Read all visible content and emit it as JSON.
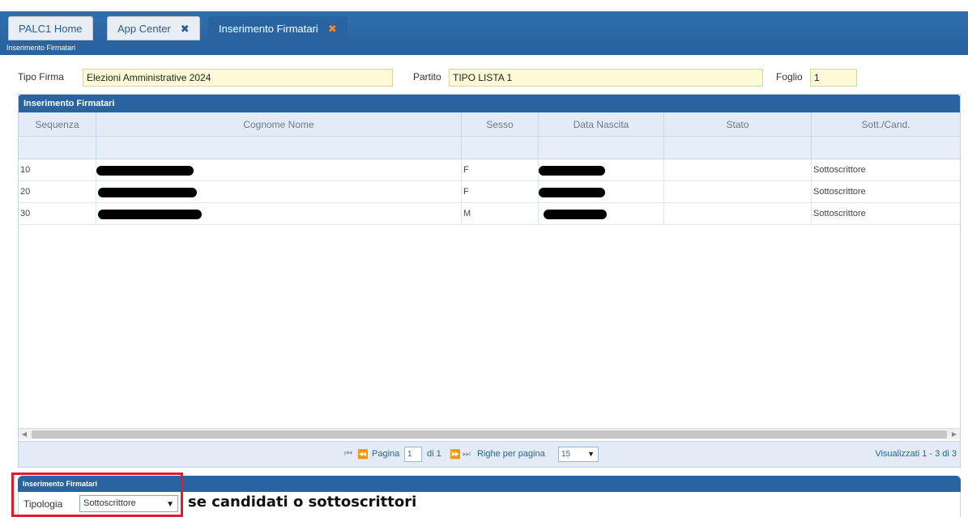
{
  "tabs": [
    {
      "label": "PALC1 Home",
      "closable": false,
      "active": false
    },
    {
      "label": "App Center",
      "close_glyph": "✖",
      "closable": true,
      "active": false
    },
    {
      "label": "Inserimento Firmatari",
      "close_glyph": "✖",
      "closable": true,
      "active": true
    }
  ],
  "subheader": "Inserimento Firmatari",
  "form": {
    "tipo_firma_label": "Tipo Firma",
    "tipo_firma_value": "Elezioni Amministrative 2024",
    "partito_label": "Partito",
    "partito_value": "TIPO LISTA 1",
    "foglio_label": "Foglio",
    "foglio_value": "1"
  },
  "grid": {
    "title": "Inserimento Firmatari",
    "columns": [
      "Sequenza",
      "Cognome Nome",
      "Sesso",
      "Data Nascita",
      "Stato",
      "Sott./Cand."
    ],
    "rows": [
      {
        "sequenza": "10",
        "sesso": "F",
        "stato": "",
        "sott_cand": "Sottoscrittore"
      },
      {
        "sequenza": "20",
        "sesso": "F",
        "stato": "",
        "sott_cand": "Sottoscrittore"
      },
      {
        "sequenza": "30",
        "sesso": "M",
        "stato": "",
        "sott_cand": "Sottoscrittore"
      }
    ],
    "pager": {
      "first_glyph": "⏮",
      "prev_glyph": "⏪",
      "page_label": "Pagina",
      "page_value": "1",
      "of_label": "di 1",
      "next_glyph": "⏩",
      "last_glyph": "⏭",
      "rows_label": "Righe per pagina",
      "rows_value": "15",
      "summary": "Visualizzati 1 - 3 di 3"
    }
  },
  "bottom": {
    "title": "Inserimento Firmatari",
    "tipologia_label": "Tipologia",
    "tipologia_value": "Sottoscrittore",
    "note": "se candidati o sottoscrittori"
  },
  "colors": {
    "header_blue": "#2a64a0",
    "field_yellow": "#fdfbd6",
    "highlight_red": "#e21b2c",
    "close_orange": "#f08a2c"
  }
}
